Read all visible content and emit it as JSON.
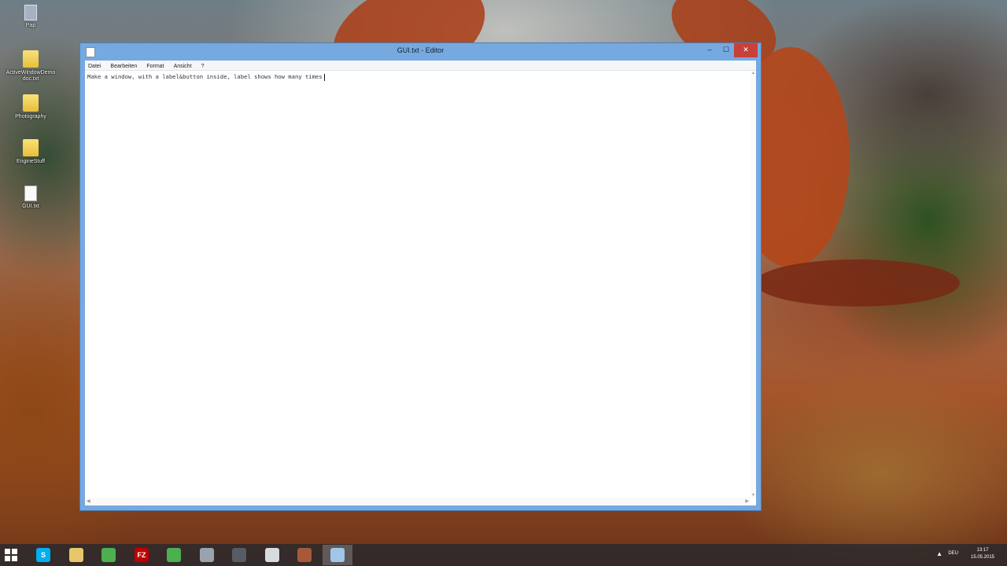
{
  "desktop": {
    "icons": [
      {
        "label": "Pap",
        "kind": "recycle-bin"
      },
      {
        "label": "ActiveWindowDemo doc.txt",
        "kind": "folder"
      },
      {
        "label": "Photography",
        "kind": "folder"
      },
      {
        "label": "EngineStuff",
        "kind": "folder"
      },
      {
        "label": "GUI.txt",
        "kind": "file"
      }
    ]
  },
  "window": {
    "title": "GUI.txt - Editor",
    "controls": {
      "minimize": "–",
      "maximize": "☐",
      "close": "✕"
    },
    "menu": [
      "Datei",
      "Bearbeiten",
      "Format",
      "Ansicht",
      "?"
    ],
    "content": "Make a window, with a label&button inside, label shows how many times"
  },
  "taskbar": {
    "apps": [
      {
        "name": "skype",
        "glyph": "S",
        "color": "#00aff0"
      },
      {
        "name": "file-explorer",
        "glyph": "",
        "color": "#e8c76a"
      },
      {
        "name": "chrome",
        "glyph": "",
        "color": "#4caf50"
      },
      {
        "name": "filezilla",
        "glyph": "FZ",
        "color": "#bf0000"
      },
      {
        "name": "chrome-2",
        "glyph": "",
        "color": "#4caf50"
      },
      {
        "name": "app-gear",
        "glyph": "",
        "color": "#9aa3ad"
      },
      {
        "name": "app-dark",
        "glyph": "",
        "color": "#565c66"
      },
      {
        "name": "app-window",
        "glyph": "",
        "color": "#d7dbe0"
      },
      {
        "name": "app-avatar",
        "glyph": "",
        "color": "#a8593a"
      },
      {
        "name": "notepad",
        "glyph": "",
        "color": "#9fc7ea"
      }
    ],
    "tray_arrow": "▲",
    "language": "DEU",
    "time": "13:17",
    "date": "15.05.2015"
  }
}
